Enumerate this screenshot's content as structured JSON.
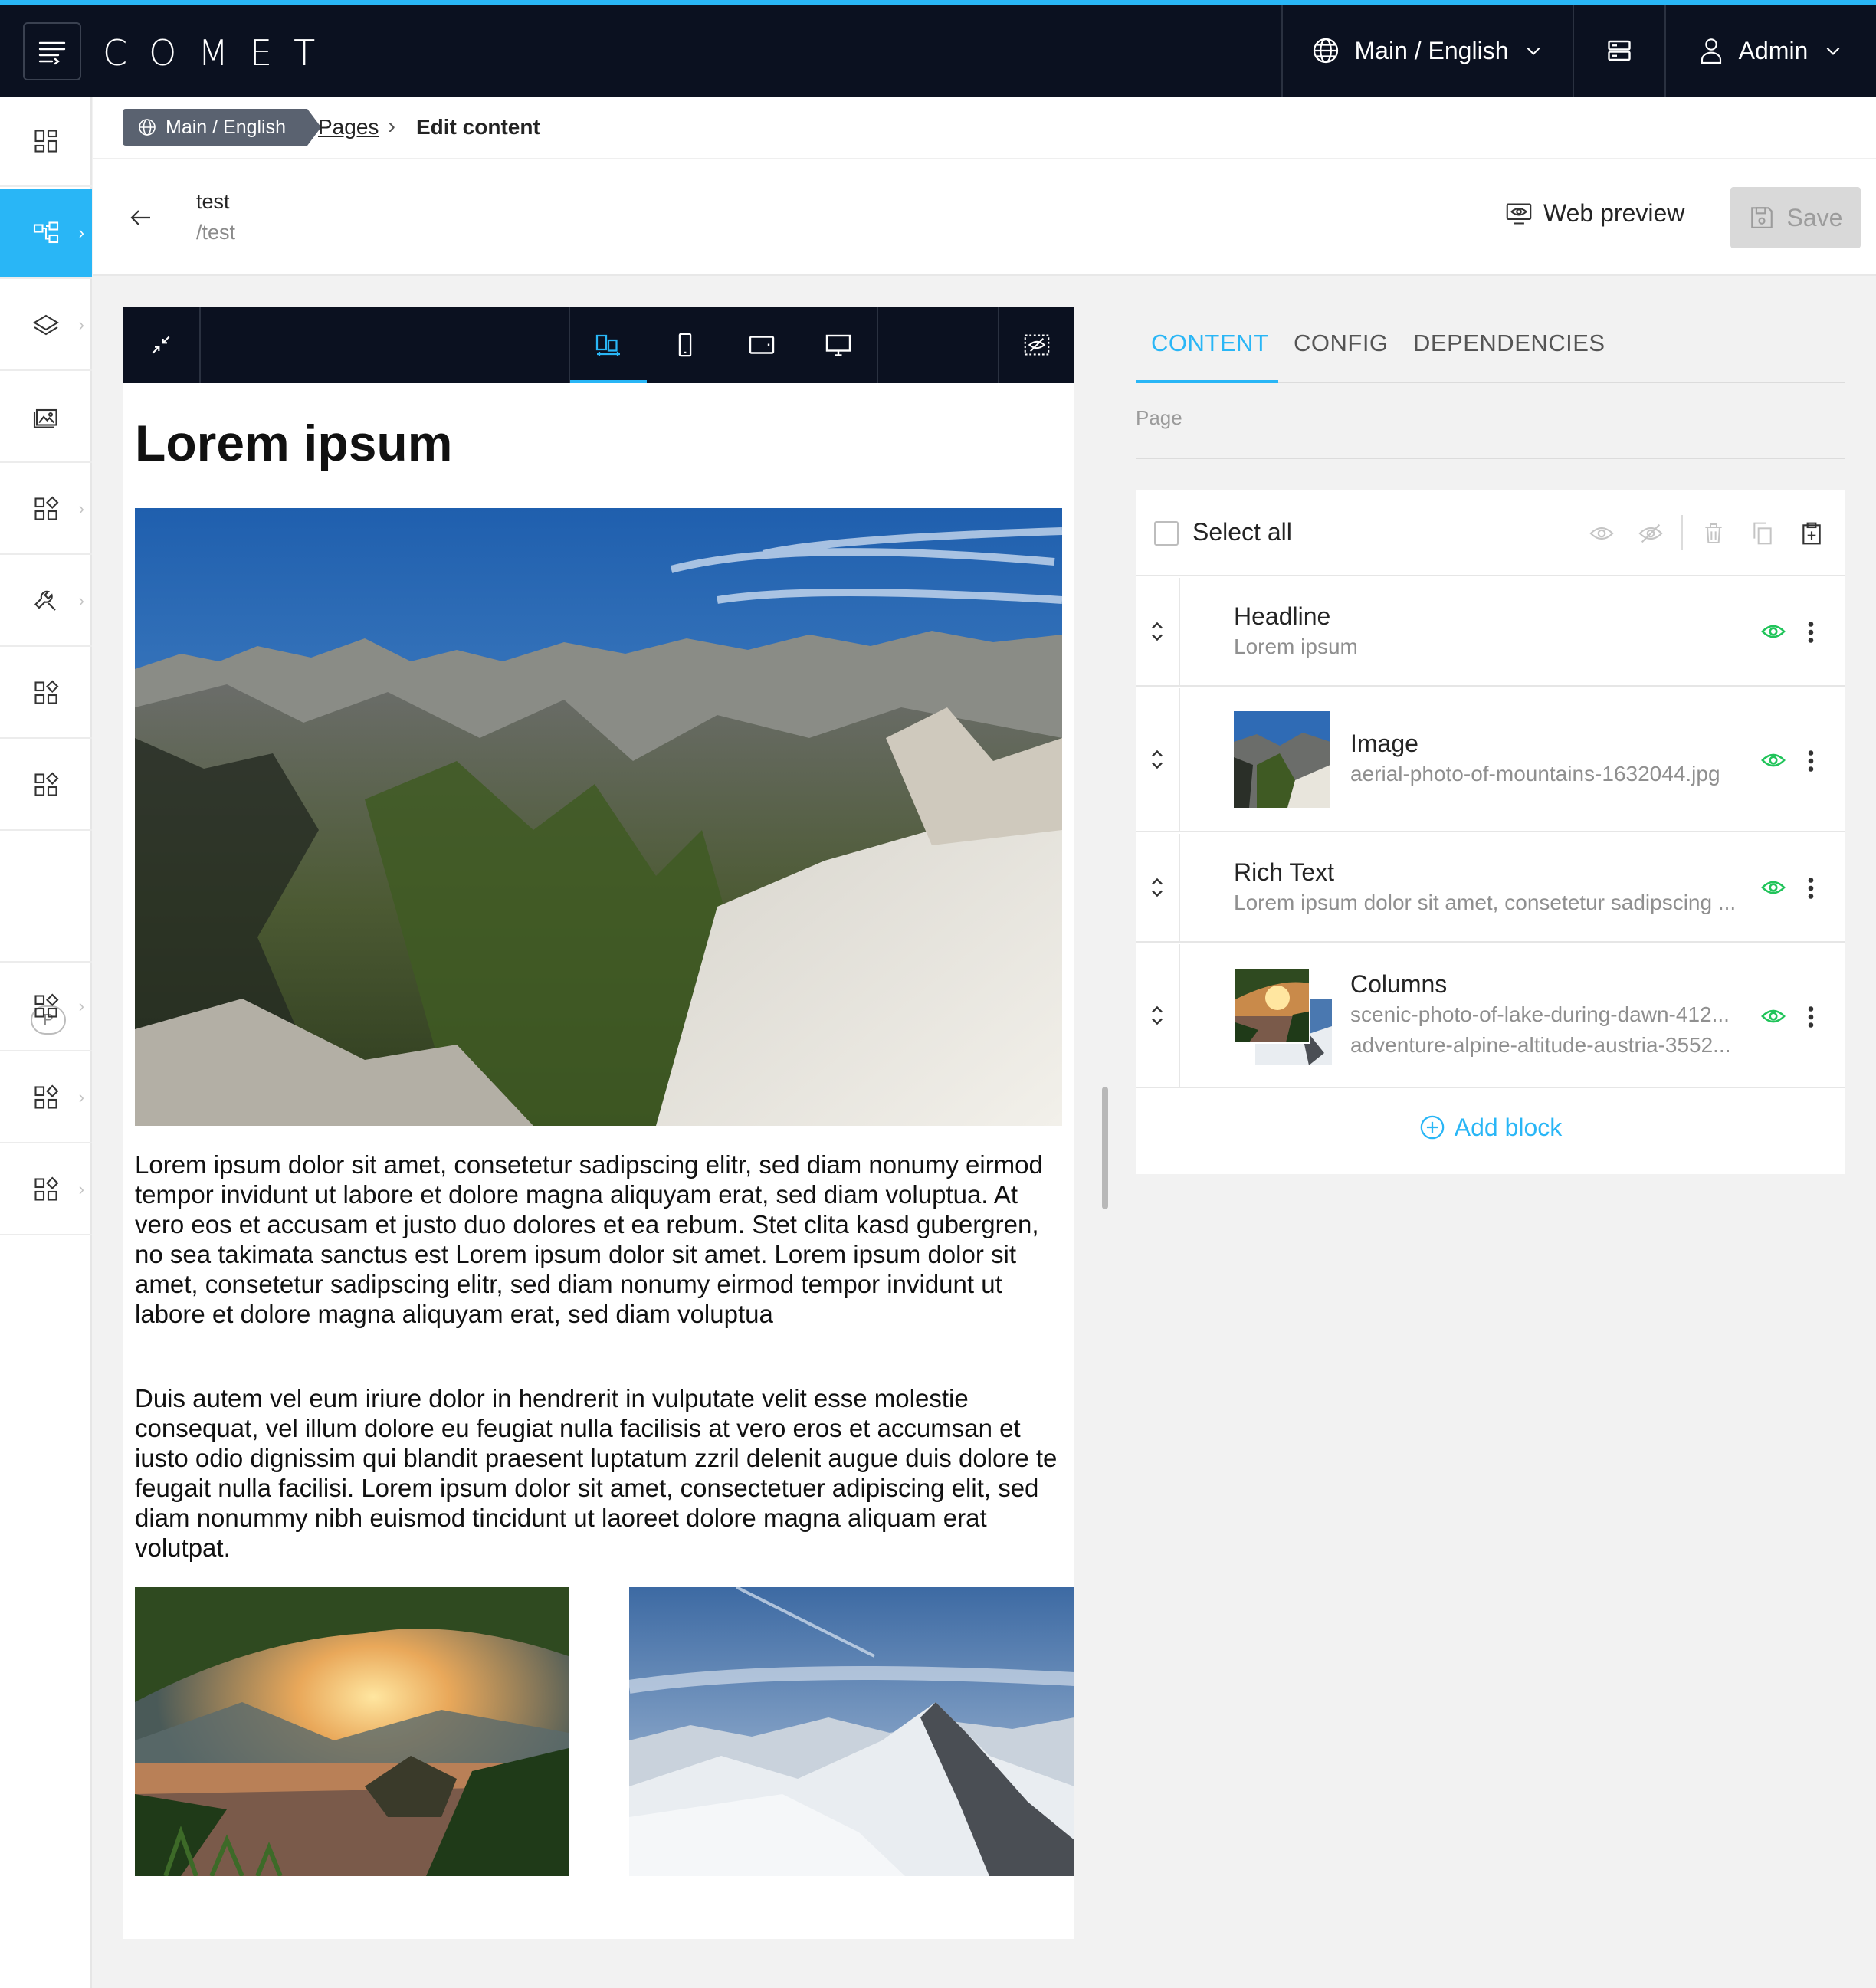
{
  "app": {
    "logo_text": "COMET",
    "accent_color": "#29b6f6",
    "topbar_color": "#0b1120"
  },
  "header": {
    "scope_label": "Main / English",
    "user_label": "Admin"
  },
  "sidebar": {
    "items": [
      {
        "icon": "dashboard-icon"
      },
      {
        "icon": "page-tree-icon",
        "active": true
      },
      {
        "icon": "layers-icon"
      },
      {
        "icon": "images-icon"
      },
      {
        "icon": "grid-icon"
      },
      {
        "icon": "wrench-icon"
      },
      {
        "icon": "grid-icon"
      },
      {
        "icon": "grid-icon"
      },
      {
        "icon": "grid-icon"
      },
      {
        "icon": "grid-icon"
      },
      {
        "icon": "grid-icon"
      }
    ],
    "p_badge": "P"
  },
  "breadcrumb": {
    "scope": "Main / English",
    "pages": "Pages",
    "current": "Edit content"
  },
  "page": {
    "title": "test",
    "path": "/test",
    "web_preview_label": "Web preview",
    "save_label": "Save"
  },
  "preview": {
    "headline": "Lorem ipsum",
    "paragraph1": "Lorem ipsum dolor sit amet, consetetur sadipscing elitr, sed diam nonumy eirmod tempor invidunt ut labore et dolore magna aliquyam erat, sed diam voluptua. At vero eos et accusam et justo duo dolores et ea rebum. Stet clita kasd gubergren, no sea takimata sanctus est Lorem ipsum dolor sit amet. Lorem ipsum dolor sit amet, consetetur sadipscing elitr, sed diam nonumy eirmod tempor invidunt ut labore et dolore magna aliquyam erat, sed diam voluptua",
    "paragraph2": "Duis autem vel eum iriure dolor in hendrerit in vulputate velit esse molestie consequat, vel illum dolore eu feugiat nulla facilisis at vero eros et accumsan et iusto odio dignissim qui blandit praesent luptatum zzril delenit augue duis dolore te feugait nulla facilisi. Lorem ipsum dolor sit amet, consectetuer adipiscing elit, sed diam nonummy nibh euismod tincidunt ut laoreet dolore magna aliquam erat volutpat."
  },
  "panel": {
    "tabs": [
      "CONTENT",
      "CONFIG",
      "DEPENDENCIES"
    ],
    "active_tab": "CONTENT",
    "section_label": "Page",
    "select_all_label": "Select all",
    "blocks": [
      {
        "title": "Headline",
        "subtitle": "Lorem ipsum",
        "visible": true
      },
      {
        "title": "Image",
        "subtitle": "aerial-photo-of-mountains-1632044.jpg",
        "visible": true
      },
      {
        "title": "Rich Text",
        "subtitle": "Lorem ipsum dolor sit amet, consetetur sadipscing ...",
        "visible": true
      },
      {
        "title": "Columns",
        "subtitle": "scenic-photo-of-lake-during-dawn-412...",
        "subtitle2": "adventure-alpine-altitude-austria-3552...",
        "visible": true
      }
    ],
    "add_block_label": "Add block"
  }
}
